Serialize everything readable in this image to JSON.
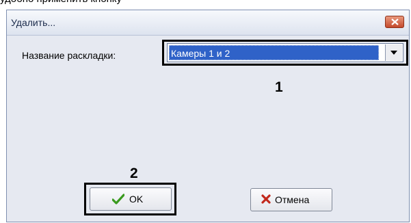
{
  "document": {
    "fragment_text": "удобно применить кнопку"
  },
  "dialog": {
    "title": "Удалить...",
    "field_label": "Название раскладки:",
    "combo_value": "Камеры 1 и 2",
    "ok_label": "OK",
    "cancel_label": "Отмена"
  },
  "callouts": {
    "one": "1",
    "two": "2"
  },
  "icons": {
    "close": "close-icon",
    "dropdown": "chevron-down-icon",
    "ok": "checkmark-icon",
    "cancel": "cross-icon"
  },
  "colors": {
    "selection": "#2f62c8",
    "check": "#3a9a1e",
    "cross": "#c2281c",
    "close_button": "#c44a2c"
  }
}
